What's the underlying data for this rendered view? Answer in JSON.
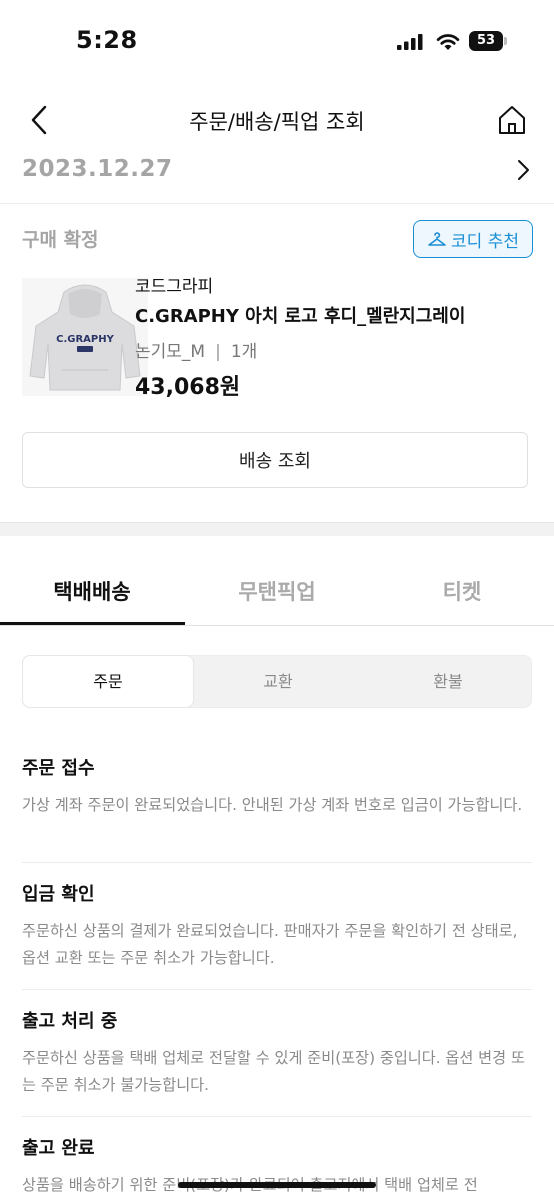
{
  "status_bar": {
    "time": "5:28",
    "battery": "53"
  },
  "nav": {
    "title": "주문/배송/픽업 조회"
  },
  "order": {
    "date": "2023.12.27",
    "status": "구매 확정",
    "codi_button": "코디 추천"
  },
  "product": {
    "brand": "코드그라피",
    "name": "C.GRAPHY 아치 로고 후디_멜란지그레이",
    "option": "논기모_M",
    "quantity": "1개",
    "price": "43,068원",
    "thumb_text": "C.GRAPHY"
  },
  "shipping_button": "배송 조회",
  "tabs": [
    "택배배송",
    "무탠픽업",
    "티켓"
  ],
  "segments": [
    "주문",
    "교환",
    "환불"
  ],
  "steps": [
    {
      "title": "주문 접수",
      "desc": "가상 계좌 주문이 완료되었습니다. 안내된 가상 계좌 번호로 입금이 가능합니다."
    },
    {
      "title": "입금 확인",
      "desc": "주문하신 상품의 결제가 완료되었습니다. 판매자가 주문을 확인하기 전 상태로, 옵션 교환 또는 주문 취소가 가능합니다."
    },
    {
      "title": "출고 처리 중",
      "desc": "주문하신 상품을 택배 업체로 전달할 수 있게 준비(포장) 중입니다. 옵션 변경 또는 주문 취소가 불가능합니다."
    },
    {
      "title": "출고 완료",
      "desc": "상품을 배송하기 위한 준비(포장)가 완료되어 출고지에서 택배 업체로 전"
    }
  ]
}
